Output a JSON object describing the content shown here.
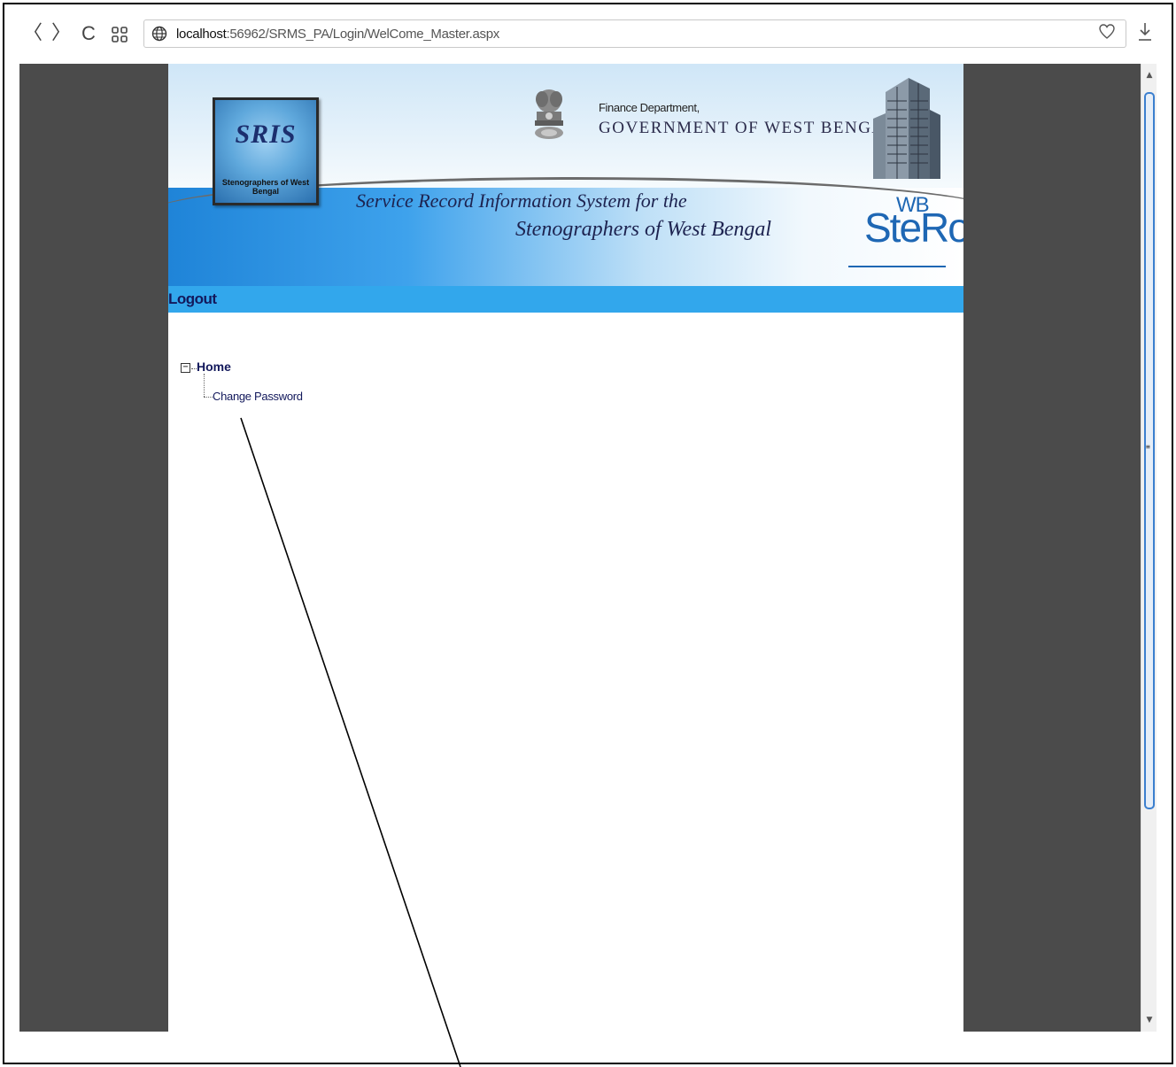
{
  "browser": {
    "url_host": "localhost",
    "url_rest": ":56962/SRMS_PA/Login/WelCome_Master.aspx",
    "back_icon": "〈",
    "forward_icon": "〉",
    "reload_icon": "C",
    "apps_icon": "▪▪",
    "globe_icon": "globe-icon",
    "heart_icon": "heart-icon",
    "download_icon": "download-icon"
  },
  "banner": {
    "logo_text": "SRIS",
    "logo_ring_text": "Stenographers of West Bengal",
    "dept_line1": "Finance Department,",
    "dept_line2": "GOVERNMENT OF WEST BENGAL",
    "tagline_line1": "Service Record Information System for the",
    "tagline_line2": "Stenographers of West Bengal",
    "brand_main": "SteRo",
    "brand_sub": "WB"
  },
  "nav": {
    "logout_label": "Logout"
  },
  "tree": {
    "root_label": "Home",
    "toggle_symbol": "−",
    "children": [
      {
        "label": "Change Password"
      }
    ]
  },
  "colors": {
    "accent_bar": "#32a7ec",
    "link_text": "#13195c",
    "viewport_bg": "#4b4b4b"
  }
}
